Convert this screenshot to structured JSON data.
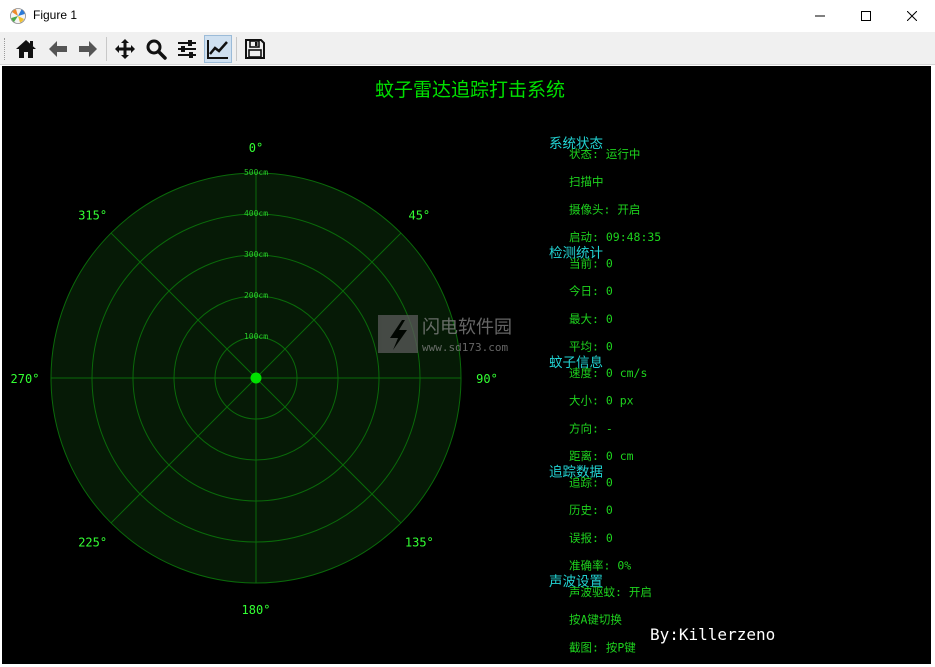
{
  "window": {
    "title": "Figure 1",
    "minimize_icon": "minimize-icon",
    "maximize_icon": "maximize-icon",
    "close_icon": "close-icon"
  },
  "toolbar": {
    "buttons": [
      {
        "icon": "home-icon",
        "active": false
      },
      {
        "icon": "back-arrow-icon",
        "active": false
      },
      {
        "icon": "forward-arrow-icon",
        "active": false
      },
      {
        "icon": "pan-icon",
        "active": false
      },
      {
        "icon": "zoom-icon",
        "active": false
      },
      {
        "icon": "configure-subplots-icon",
        "active": false
      },
      {
        "icon": "edit-axis-icon",
        "active": true
      },
      {
        "icon": "save-icon",
        "active": false
      }
    ]
  },
  "figure": {
    "title": "蚊子雷达追踪打击系统",
    "colors": {
      "background": "#000000",
      "title": "#00e000",
      "radar_grid": "#0a6a0a",
      "radar_fill": "#061a06",
      "radar_text": "#33ff33",
      "section_header": "#22d3d3",
      "info_text": "#1ed31e",
      "signature": "#ffffff"
    },
    "radar": {
      "direction_labels": [
        "0°",
        "45°",
        "90°",
        "135°",
        "180°",
        "225°",
        "270°",
        "315°"
      ],
      "range_labels": [
        "100cm",
        "200cm",
        "300cm",
        "400cm",
        "500cm"
      ],
      "target_dot": "radar-center-dot"
    },
    "panel": {
      "sections": [
        {
          "header": "系统状态",
          "lines": [
            "状态: 运行中",
            "扫描中",
            "摄像头: 开启",
            "启动: 09:48:35"
          ]
        },
        {
          "header": "检测统计",
          "lines": [
            "当前: 0",
            "今日: 0",
            "最大: 0",
            "平均: 0"
          ]
        },
        {
          "header": "蚊子信息",
          "lines": [
            "速度: 0 cm/s",
            "大小: 0 px",
            "方向: -",
            "距离: 0 cm"
          ]
        },
        {
          "header": "追踪数据",
          "lines": [
            "追踪: 0",
            "历史: 0",
            "误报: 0",
            "准确率: 0%"
          ]
        },
        {
          "header": "声波设置",
          "lines": [
            "声波驱蚊: 开启",
            "按A键切换",
            "截图: 按P键"
          ]
        }
      ]
    },
    "watermark": {
      "name": "闪电软件园",
      "url": "www.sd173.com"
    },
    "signature": "By:Killerzeno"
  }
}
